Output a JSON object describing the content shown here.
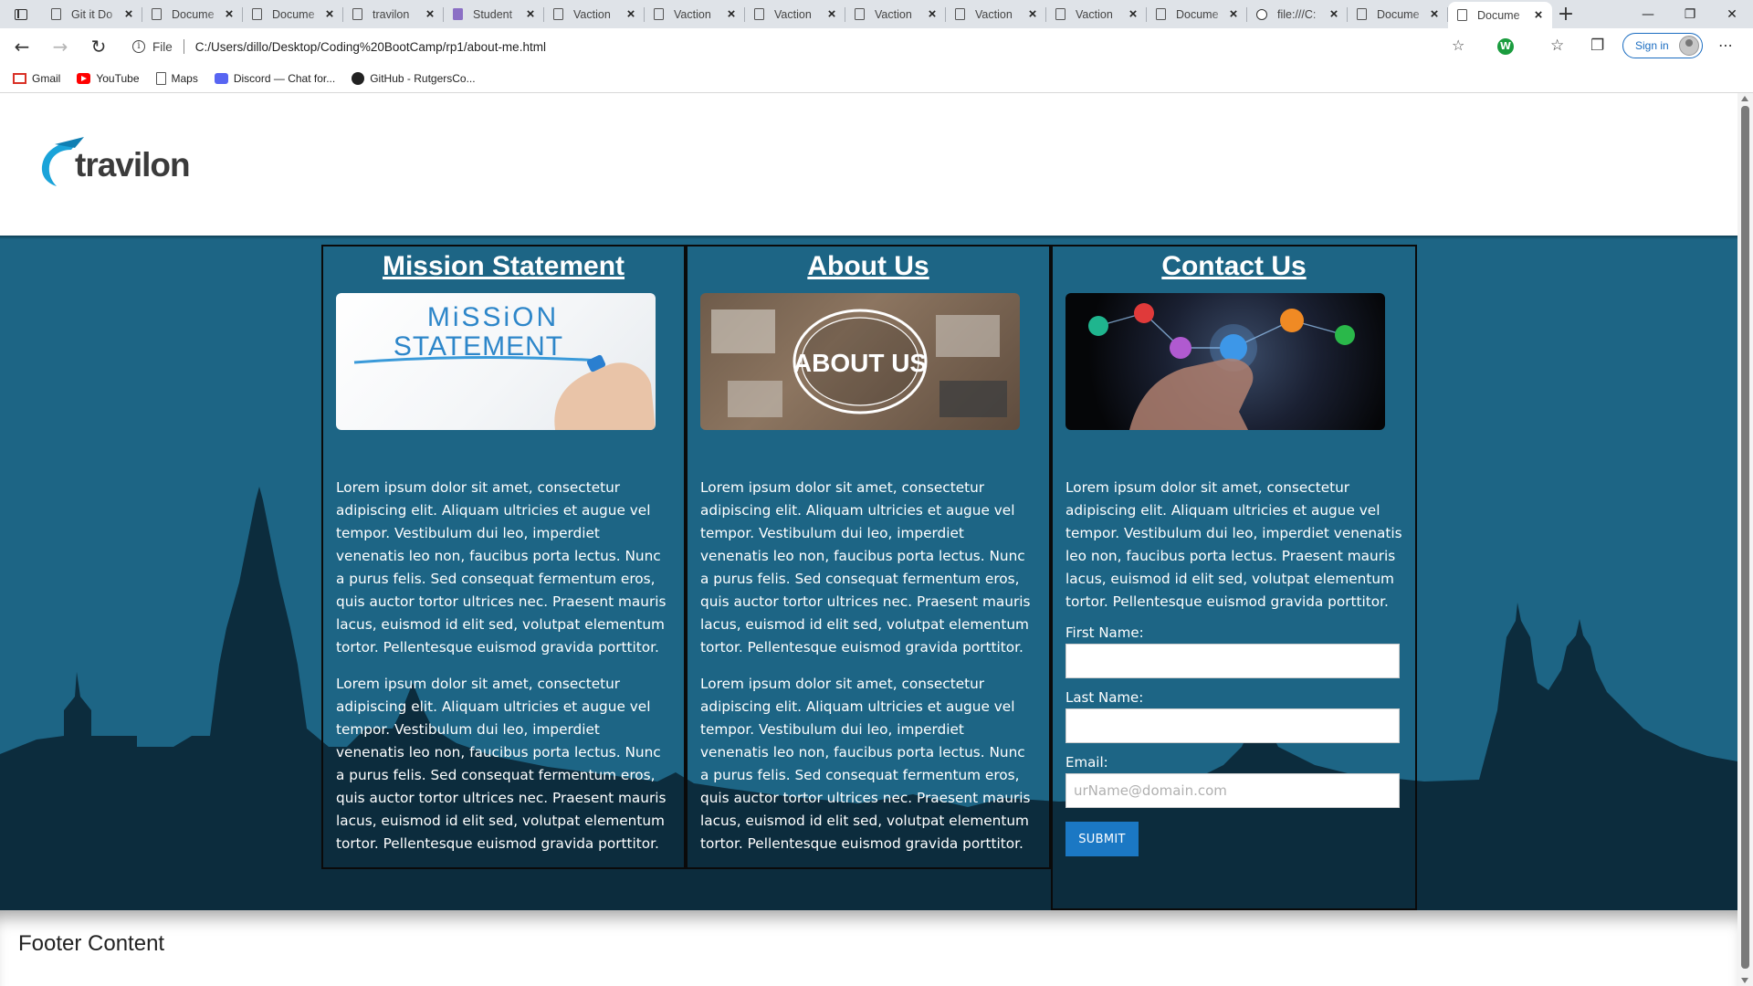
{
  "browser": {
    "tabs": [
      {
        "title": "Git it Do",
        "icon": "page-icon"
      },
      {
        "title": "Docume",
        "icon": "page-icon"
      },
      {
        "title": "Docume",
        "icon": "page-icon"
      },
      {
        "title": "travilon",
        "icon": "page-icon"
      },
      {
        "title": "Student",
        "icon": "form-icon"
      },
      {
        "title": "Vaction",
        "icon": "page-icon"
      },
      {
        "title": "Vaction",
        "icon": "page-icon"
      },
      {
        "title": "Vaction",
        "icon": "page-icon"
      },
      {
        "title": "Vaction",
        "icon": "page-icon"
      },
      {
        "title": "Vaction",
        "icon": "page-icon"
      },
      {
        "title": "Vaction",
        "icon": "page-icon"
      },
      {
        "title": "Docume",
        "icon": "page-icon"
      },
      {
        "title": "file:///C:",
        "icon": "globe-icon"
      },
      {
        "title": "Docume",
        "icon": "page-icon"
      },
      {
        "title": "Docume",
        "icon": "page-icon",
        "active": true
      }
    ],
    "address": {
      "scheme_label": "File",
      "url": "C:/Users/dillo/Desktop/Coding%20BootCamp/rp1/about-me.html"
    },
    "signin_label": "Sign in",
    "bookmarks": [
      {
        "label": "Gmail",
        "icon": "gmail-icon"
      },
      {
        "label": "YouTube",
        "icon": "youtube-icon"
      },
      {
        "label": "Maps",
        "icon": "page-icon"
      },
      {
        "label": "Discord — Chat for...",
        "icon": "discord-icon"
      },
      {
        "label": "GitHub - RutgersCo...",
        "icon": "github-icon"
      }
    ]
  },
  "site": {
    "logo_text": "travilon",
    "columns": {
      "mission": {
        "heading": "Mission Statement",
        "image_text_1": "MiSSiON",
        "image_text_2": "STATEMENT",
        "para1": "Lorem ipsum dolor sit amet, consectetur adipiscing elit. Aliquam ultricies et augue vel tempor. Vestibulum dui leo, imperdiet venenatis leo non, faucibus porta lectus. Nunc a purus felis. Sed consequat fermentum eros, quis auctor tortor ultrices nec. Praesent mauris lacus, euismod id elit sed, volutpat elementum tortor. Pellentesque euismod gravida porttitor.",
        "para2": "Lorem ipsum dolor sit amet, consectetur adipiscing elit. Aliquam ultricies et augue vel tempor. Vestibulum dui leo, imperdiet venenatis leo non, faucibus porta lectus. Nunc a purus felis. Sed consequat fermentum eros, quis auctor tortor ultrices nec. Praesent mauris lacus, euismod id elit sed, volutpat elementum tortor. Pellentesque euismod gravida porttitor."
      },
      "about": {
        "heading": "About Us",
        "image_text": "ABOUT US",
        "para1": "Lorem ipsum dolor sit amet, consectetur adipiscing elit. Aliquam ultricies et augue vel tempor. Vestibulum dui leo, imperdiet venenatis leo non, faucibus porta lectus. Nunc a purus felis. Sed consequat fermentum eros, quis auctor tortor ultrices nec. Praesent mauris lacus, euismod id elit sed, volutpat elementum tortor. Pellentesque euismod gravida porttitor.",
        "para2": "Lorem ipsum dolor sit amet, consectetur adipiscing elit. Aliquam ultricies et augue vel tempor. Vestibulum dui leo, imperdiet venenatis leo non, faucibus porta lectus. Nunc a purus felis. Sed consequat fermentum eros, quis auctor tortor ultrices nec. Praesent mauris lacus, euismod id elit sed, volutpat elementum tortor. Pellentesque euismod gravida porttitor."
      },
      "contact": {
        "heading": "Contact Us",
        "para1": "Lorem ipsum dolor sit amet, consectetur adipiscing elit. Aliquam ultricies et augue vel tempor. Vestibulum dui leo, imperdiet venenatis leo non, faucibus porta lectus. Praesent mauris lacus, euismod id elit sed, volutpat elementum tortor. Pellentesque euismod gravida porttitor.",
        "form": {
          "first_name_label": "First Name:",
          "first_name_value": "",
          "last_name_label": "Last Name:",
          "last_name_value": "",
          "email_label": "Email:",
          "email_placeholder": "urName@domain.com",
          "submit_label": "SUBMIT"
        }
      }
    },
    "footer_text": "Footer Content"
  },
  "colors": {
    "main_bg": "#1d6585",
    "skyline": "#0c2c3d",
    "submit": "#1b78c4",
    "logo_blue": "#1aa3d9"
  }
}
